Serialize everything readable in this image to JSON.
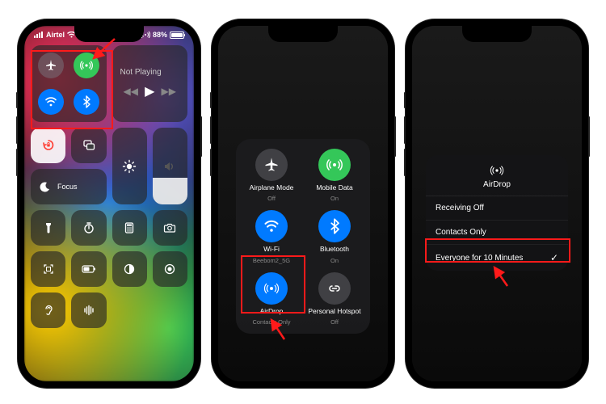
{
  "phone1": {
    "status": {
      "carrier": "Airtel",
      "battery_pct": "88%"
    },
    "media": {
      "title": "Not Playing"
    },
    "focus_label": "Focus"
  },
  "phone2": {
    "items": [
      {
        "label": "Airplane Mode",
        "sub": "Off"
      },
      {
        "label": "Mobile Data",
        "sub": "On"
      },
      {
        "label": "Wi-Fi",
        "sub": "Beebom2_5G"
      },
      {
        "label": "Bluetooth",
        "sub": "On"
      },
      {
        "label": "AirDrop",
        "sub": "Contacts Only"
      },
      {
        "label": "Personal Hotspot",
        "sub": "Off"
      }
    ]
  },
  "phone3": {
    "title": "AirDrop",
    "options": [
      {
        "label": "Receiving Off",
        "selected": false
      },
      {
        "label": "Contacts Only",
        "selected": false
      },
      {
        "label": "Everyone for 10 Minutes",
        "selected": true
      }
    ]
  }
}
